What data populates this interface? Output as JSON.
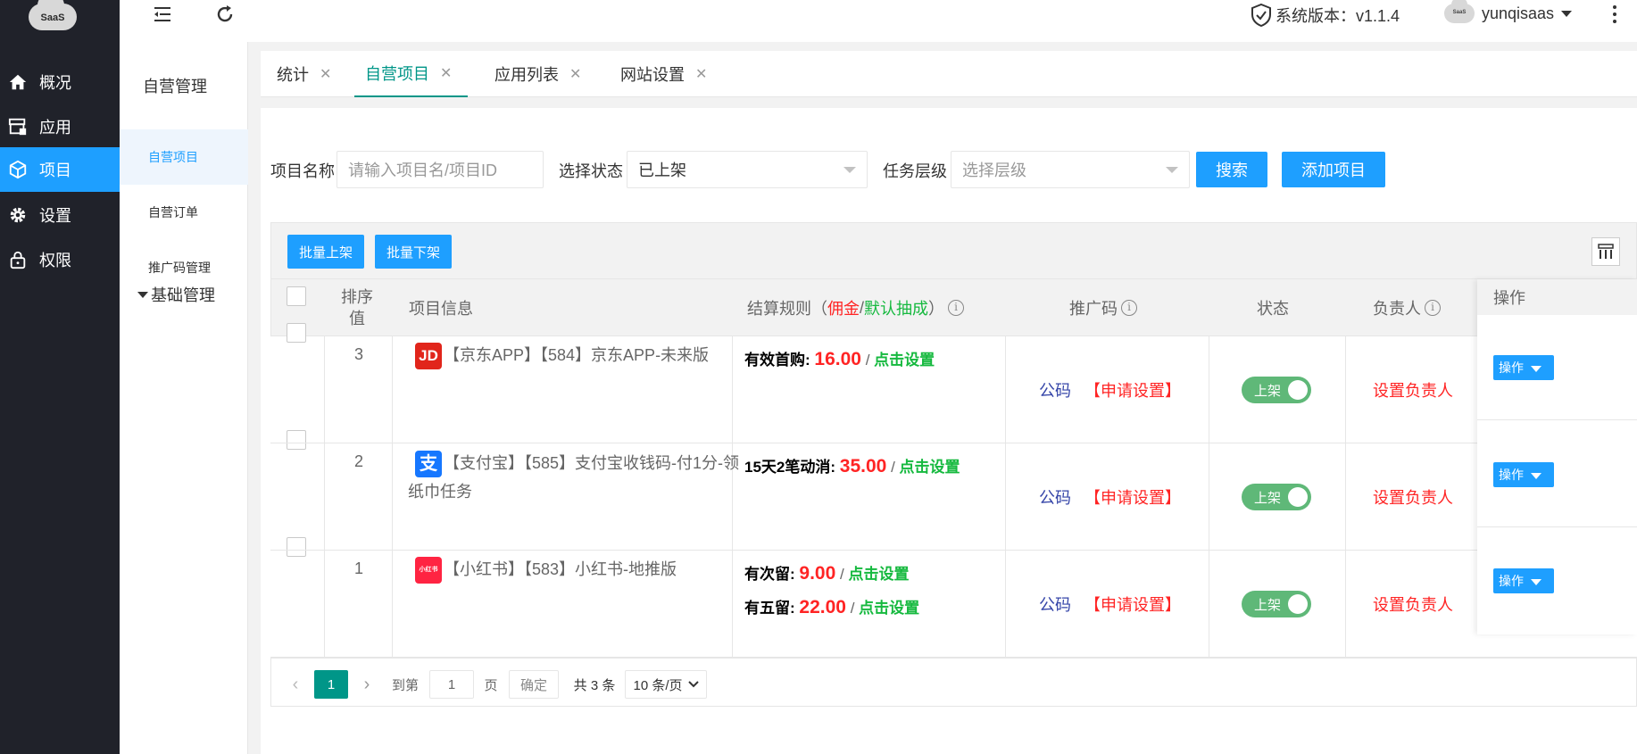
{
  "logo": {
    "text": "SaaS"
  },
  "nav": {
    "items": [
      {
        "label": "概况",
        "icon": "home-icon"
      },
      {
        "label": "应用",
        "icon": "store-icon"
      },
      {
        "label": "项目",
        "icon": "cube-icon",
        "active": true
      },
      {
        "label": "设置",
        "icon": "gear-icon"
      },
      {
        "label": "权限",
        "icon": "lock-icon"
      }
    ]
  },
  "submenu": {
    "title": "自营管理",
    "items": [
      {
        "label": "自营项目",
        "active": true
      },
      {
        "label": "自营订单"
      },
      {
        "label": "推广码管理"
      }
    ],
    "group": "基础管理"
  },
  "header": {
    "version": "系统版本：v1.1.4",
    "user": "yunqisaas",
    "avatar_text": "SaaS"
  },
  "tabs": [
    {
      "label": "统计"
    },
    {
      "label": "自营项目",
      "active": true
    },
    {
      "label": "应用列表"
    },
    {
      "label": "网站设置"
    }
  ],
  "search": {
    "name_label": "项目名称",
    "name_placeholder": "请输入项目名/项目ID",
    "status_label": "选择状态",
    "status_value": "已上架",
    "level_label": "任务层级",
    "level_placeholder": "选择层级",
    "search_btn": "搜索",
    "add_btn": "添加项目"
  },
  "toolbar": {
    "batch_on": "批量上架",
    "batch_off": "批量下架"
  },
  "table": {
    "headers": {
      "sort_line1": "排序",
      "sort_line2": "值",
      "info": "项目信息",
      "rule_prefix": "结算规则（",
      "rule_commission": "佣金",
      "rule_sep": "/",
      "rule_default": "默认抽成",
      "rule_suffix": "）",
      "code": "推广码",
      "status": "状态",
      "owner": "负责人",
      "op": "操作"
    },
    "rows": [
      {
        "sort": "3",
        "logo": "JD",
        "logo_color": "#e1251b",
        "name": "【京东APP】【584】京东APP-未来版",
        "rules": [
          {
            "label": "有效首购",
            "amount": "16.00",
            "set": "点击设置"
          }
        ],
        "code_public": "公码",
        "code_apply": "【申请设置】",
        "status": "上架",
        "owner": "设置负责人",
        "op": "操作"
      },
      {
        "sort": "2",
        "logo": "支",
        "logo_color": "#1677ff",
        "name": "【支付宝】【585】支付宝收钱码-付1分-领纸巾任务",
        "rules": [
          {
            "label": "15天2笔动消",
            "amount": "35.00",
            "set": "点击设置"
          }
        ],
        "code_public": "公码",
        "code_apply": "【申请设置】",
        "status": "上架",
        "owner": "设置负责人",
        "op": "操作"
      },
      {
        "sort": "1",
        "logo": "小红书",
        "logo_color": "#ff2442",
        "name": "【小红书】【583】小红书-地推版",
        "rules": [
          {
            "label": "有次留",
            "amount": "9.00",
            "set": "点击设置"
          },
          {
            "label": "有五留",
            "amount": "22.00",
            "set": "点击设置"
          }
        ],
        "code_public": "公码",
        "code_apply": "【申请设置】",
        "status": "上架",
        "owner": "设置负责人",
        "op": "操作"
      }
    ]
  },
  "pager": {
    "current": "1",
    "goto_label": "到第",
    "goto_value": "1",
    "page_label": "页",
    "confirm": "确定",
    "total": "共 3 条",
    "per_page": "10 条/页"
  },
  "colors": {
    "primary": "#1e9fff",
    "teal": "#009688",
    "red": "#ff2424",
    "green": "#16b93f",
    "switch": "#5fb878",
    "nav_bg": "#20222a"
  }
}
